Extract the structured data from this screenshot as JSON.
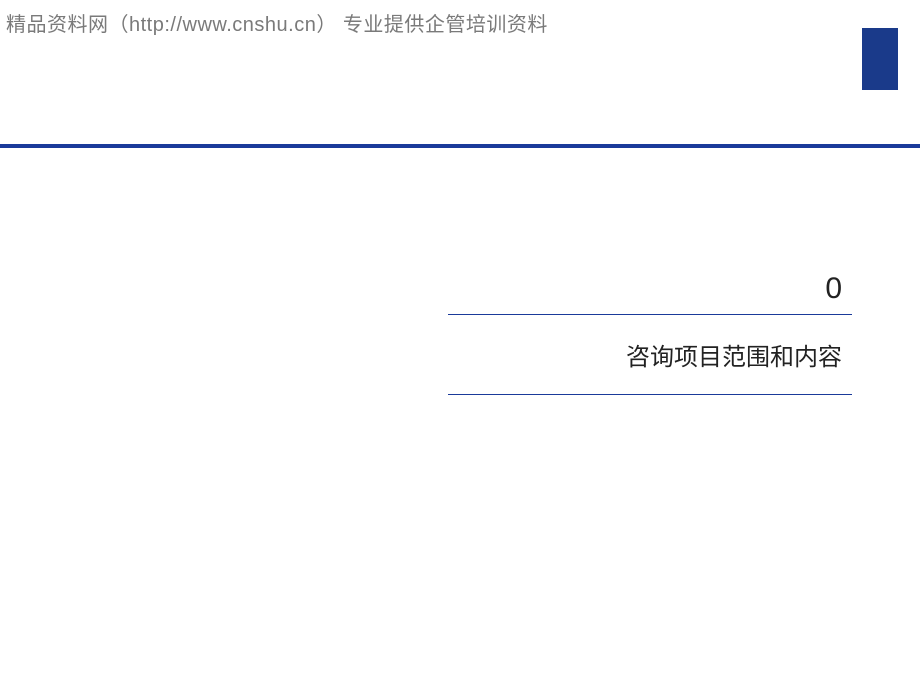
{
  "watermark": {
    "text": "精品资料网（http://www.cnshu.cn） 专业提供企管培训资料"
  },
  "section": {
    "number": "0",
    "title": "咨询项目范围和内容"
  },
  "colors": {
    "accent": "#1a3a9a",
    "corner": "#1a3a8a",
    "text": "#222222",
    "watermark": "#7a7a7a"
  }
}
